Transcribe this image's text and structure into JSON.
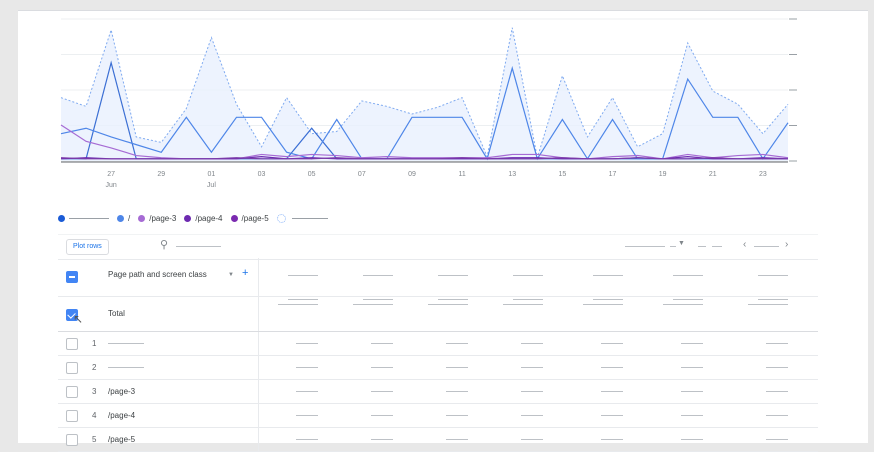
{
  "chart_data": {
    "type": "line",
    "x_ticks": [
      {
        "day": "27",
        "month": "Jun"
      },
      {
        "day": "29",
        "month": ""
      },
      {
        "day": "01",
        "month": "Jul"
      },
      {
        "day": "03",
        "month": ""
      },
      {
        "day": "05",
        "month": ""
      },
      {
        "day": "07",
        "month": ""
      },
      {
        "day": "09",
        "month": ""
      },
      {
        "day": "11",
        "month": ""
      },
      {
        "day": "13",
        "month": ""
      },
      {
        "day": "15",
        "month": ""
      },
      {
        "day": "17",
        "month": ""
      },
      {
        "day": "19",
        "month": ""
      },
      {
        "day": "21",
        "month": ""
      },
      {
        "day": "23",
        "month": ""
      }
    ],
    "x": [
      25,
      26,
      27,
      28,
      29,
      30,
      1,
      2,
      3,
      4,
      5,
      6,
      7,
      8,
      9,
      10,
      11,
      12,
      13,
      14,
      15,
      16,
      17,
      18,
      19,
      20,
      21,
      22,
      23
    ],
    "y_max": 130,
    "series": [
      {
        "color": "#7faaf0",
        "dashed": true,
        "values": [
          58,
          50,
          120,
          22,
          17,
          48,
          113,
          52,
          13,
          58,
          25,
          27,
          55,
          50,
          43,
          49,
          58,
          4,
          122,
          3,
          78,
          22,
          58,
          13,
          25,
          108,
          64,
          52,
          25,
          52
        ]
      },
      {
        "color": "#3b6fd4",
        "values": [
          2,
          2,
          90,
          2,
          2,
          2,
          2,
          2,
          2,
          2,
          30,
          2,
          2,
          2,
          2,
          2,
          2,
          2,
          2,
          2,
          2,
          2,
          2,
          2,
          2,
          2,
          2,
          2,
          2,
          2
        ]
      },
      {
        "color": "#4e86e8",
        "values": [
          25,
          30,
          22,
          15,
          8,
          40,
          8,
          40,
          40,
          8,
          2,
          38,
          2,
          2,
          40,
          40,
          40,
          2,
          85,
          2,
          38,
          2,
          38,
          2,
          2,
          75,
          40,
          40,
          2,
          35
        ]
      },
      {
        "color": "#a66bd4",
        "values": [
          33,
          18,
          12,
          5,
          3,
          2,
          2,
          2,
          6,
          4,
          6,
          5,
          3,
          4,
          3,
          3,
          3,
          3,
          6,
          6,
          3,
          2,
          4,
          5,
          2,
          6,
          3,
          5,
          6,
          3
        ]
      },
      {
        "color": "#6d2ab0",
        "values": [
          2,
          3,
          2,
          2,
          2,
          2,
          2,
          2,
          4,
          2,
          3,
          2,
          2,
          2,
          2,
          2,
          2,
          2,
          3,
          3,
          2,
          2,
          2,
          3,
          2,
          4,
          2,
          2,
          3,
          2
        ]
      },
      {
        "color": "#7b3aa8",
        "values": [
          3,
          2,
          2,
          2,
          2,
          2,
          2,
          3,
          2,
          2,
          2,
          3,
          2,
          2,
          2,
          2,
          3,
          2,
          2,
          2,
          3,
          2,
          2,
          3,
          2,
          2,
          3,
          2,
          2,
          2
        ]
      }
    ]
  },
  "legend": {
    "items": [
      {
        "color": "#1a5bd6",
        "label": ""
      },
      {
        "color": "#4e86e8",
        "label": "/"
      },
      {
        "color": "#a66bd4",
        "label": "/page-3"
      },
      {
        "color": "#6d2ab0",
        "label": "/page-4"
      },
      {
        "color": "#7b2ab0",
        "label": "/page-5"
      }
    ]
  },
  "toolbar": {
    "plot_rows_label": "Plot rows"
  },
  "table": {
    "dimension_header": "Page path and screen class",
    "add_symbol": "+",
    "total_label": "Total",
    "rows": [
      {
        "index": "1",
        "label": ""
      },
      {
        "index": "2",
        "label": ""
      },
      {
        "index": "3",
        "label": "/page-3"
      },
      {
        "index": "4",
        "label": "/page-4"
      },
      {
        "index": "5",
        "label": "/page-5"
      }
    ]
  }
}
